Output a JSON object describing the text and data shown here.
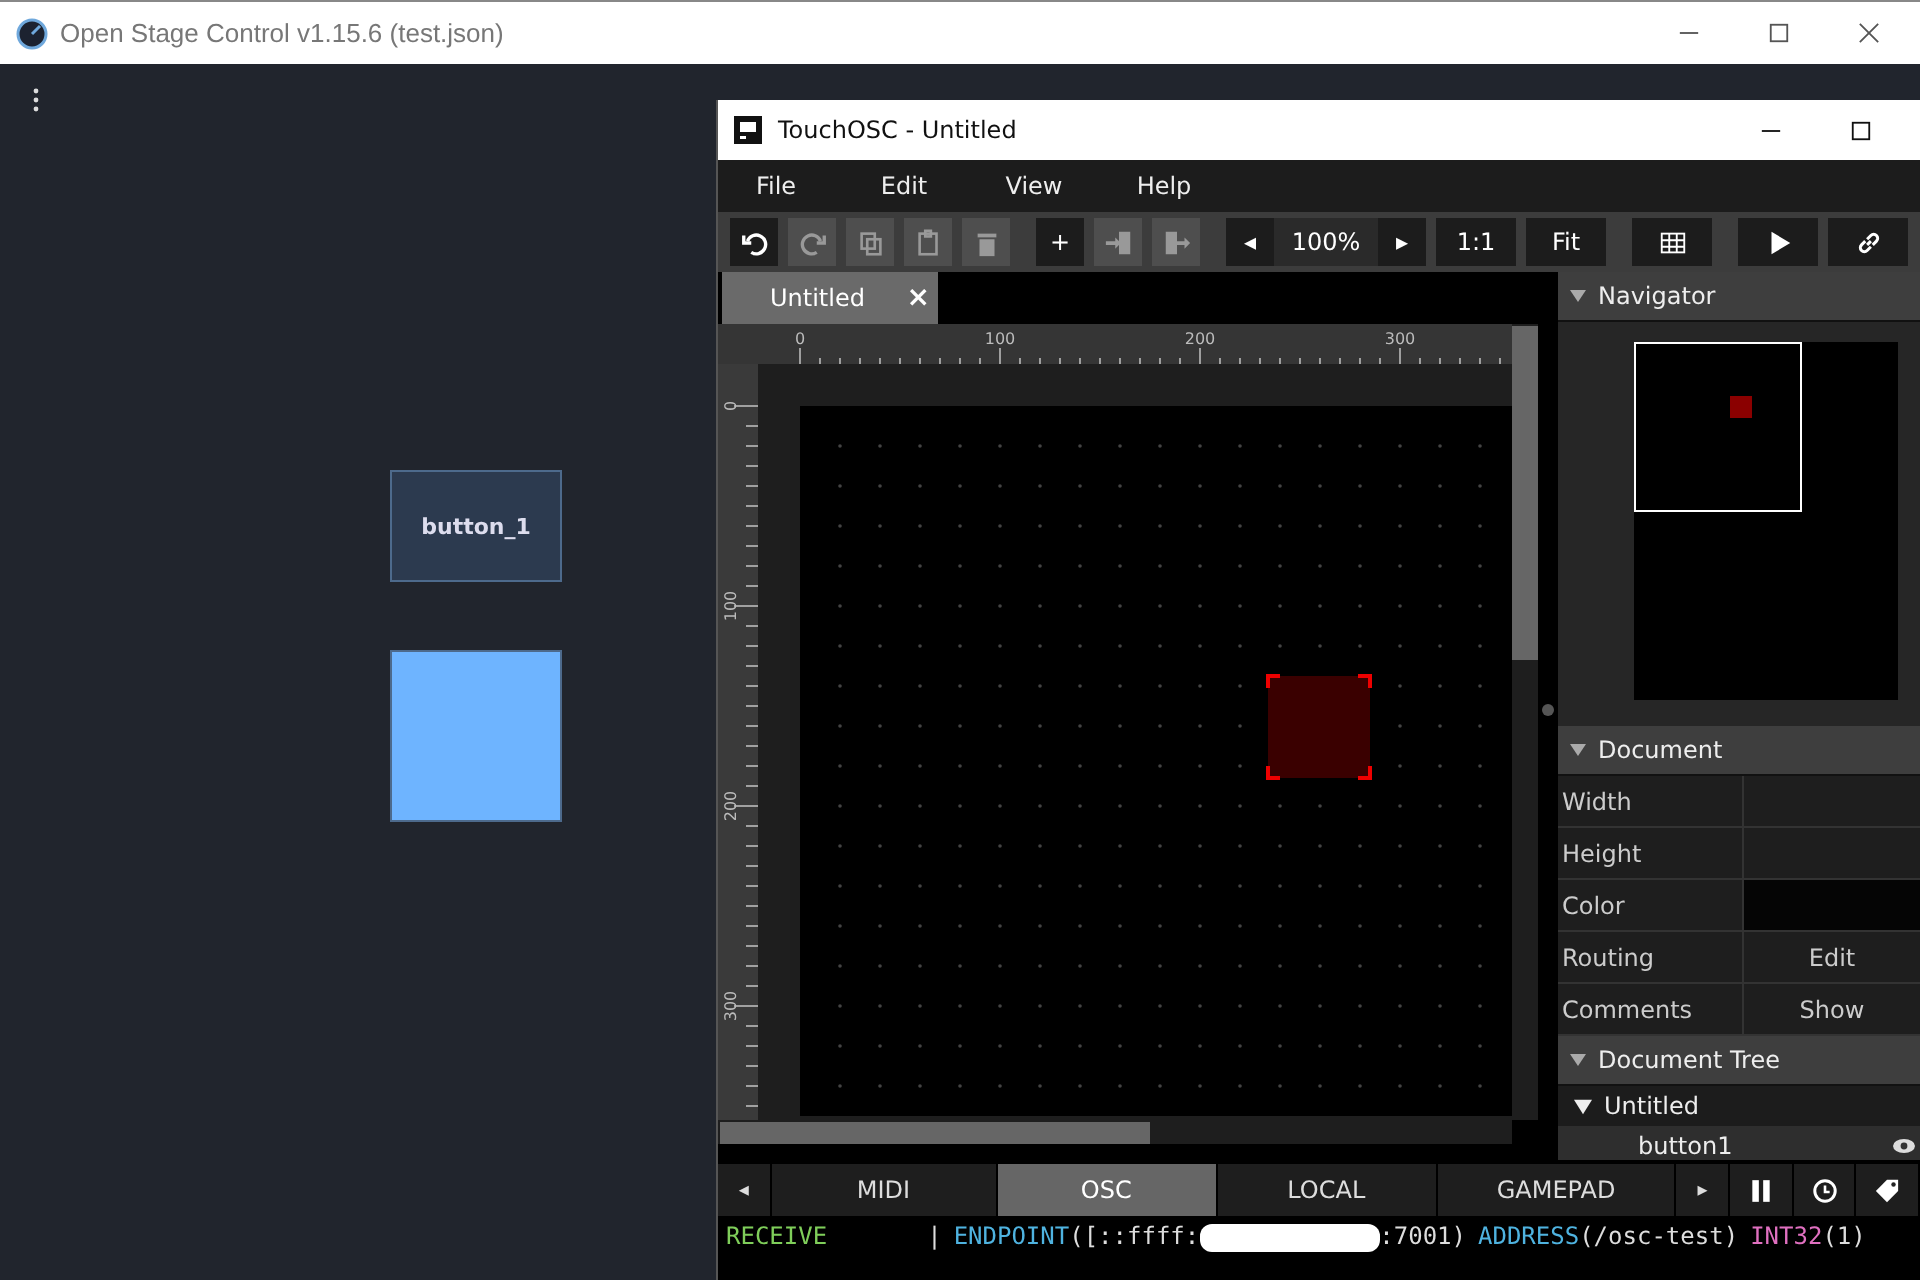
{
  "window": {
    "title": "Open Stage Control v1.15.6 (test.json)"
  },
  "widgets": [
    {
      "kind": "button",
      "label": "button_1"
    },
    {
      "kind": "pad"
    }
  ],
  "touchosc": {
    "title": "TouchOSC - Untitled",
    "menu": [
      "File",
      "Edit",
      "View",
      "Help"
    ],
    "toolbar": [
      {
        "kind": "undo",
        "disabled": false
      },
      {
        "kind": "redo",
        "disabled": true
      },
      {
        "kind": "copy",
        "disabled": true
      },
      {
        "kind": "paste",
        "disabled": true
      },
      {
        "kind": "delete",
        "disabled": true
      },
      {
        "kind": "text",
        "label": "+",
        "disabled": false
      },
      {
        "kind": "import",
        "disabled": true
      },
      {
        "kind": "export",
        "disabled": true
      },
      {
        "kind": "text",
        "label": "◂",
        "disabled": false
      },
      {
        "kind": "value",
        "label": "100%",
        "disabled": false
      },
      {
        "kind": "text",
        "label": "▸",
        "disabled": false
      },
      {
        "kind": "text",
        "label": "1:1",
        "disabled": false
      },
      {
        "kind": "text",
        "label": "Fit",
        "disabled": false
      },
      {
        "kind": "grid",
        "disabled": false
      },
      {
        "kind": "play",
        "disabled": false
      },
      {
        "kind": "link",
        "disabled": false
      }
    ],
    "tab": {
      "label": "Untitled",
      "close": "×"
    },
    "ruler": {
      "x_labels": [
        "0",
        "100",
        "200",
        "300"
      ],
      "y_labels": [
        "0",
        "100",
        "200",
        "300"
      ]
    },
    "navigator": {
      "title": "Navigator"
    },
    "document": {
      "title": "Document",
      "rows": [
        {
          "label": "Width"
        },
        {
          "label": "Height"
        },
        {
          "label": "Color"
        },
        {
          "label": "Routing",
          "value": "Edit"
        },
        {
          "label": "Comments",
          "value": "Show"
        }
      ]
    },
    "tree": {
      "title": "Document Tree",
      "items": [
        {
          "label": "Untitled",
          "expanded": true,
          "children": [
            {
              "label": "button1",
              "visible": true
            }
          ]
        }
      ]
    },
    "bottom_tabs": [
      {
        "label": "MIDI",
        "selected": false
      },
      {
        "label": "OSC",
        "selected": true
      },
      {
        "label": "LOCAL",
        "selected": false
      },
      {
        "label": "GAMEPAD",
        "selected": false
      }
    ],
    "tab_prev": "◂",
    "tab_next": "▸",
    "log": [
      {
        "segments": [
          {
            "kind": "direction",
            "text": "RECEIVE"
          },
          {
            "kind": "plain",
            "text": "|"
          },
          {
            "kind": "key",
            "text": "ENDPOINT"
          },
          {
            "kind": "plain",
            "text": "([::ffff:"
          },
          {
            "kind": "redacted"
          },
          {
            "kind": "plain",
            "text": ":7001)"
          },
          {
            "kind": "key",
            "text": "ADDRESS"
          },
          {
            "kind": "plain",
            "text": "(/osc-test)"
          },
          {
            "kind": "type",
            "text": "INT32"
          },
          {
            "kind": "plain",
            "text": "(1)"
          }
        ]
      }
    ]
  }
}
